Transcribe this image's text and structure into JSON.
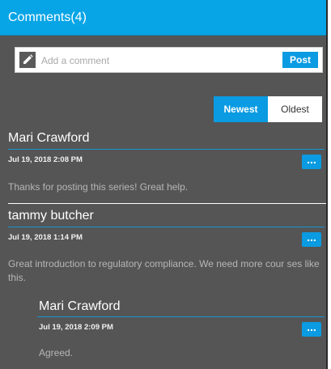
{
  "header": {
    "title": "Comments(4)"
  },
  "compose": {
    "placeholder": "Add a comment",
    "post_label": "Post",
    "icon": "pencil-icon"
  },
  "sort": {
    "options": [
      "Newest",
      "Oldest"
    ],
    "selected": "Newest"
  },
  "comments": [
    {
      "author": "Mari Crawford",
      "date": "Jul 19, 2018 2:08 PM",
      "text": "Thanks for posting this series! Great help.",
      "more_label": "..."
    },
    {
      "author": "tammy butcher",
      "date": "Jul 19, 2018 1:14 PM",
      "text": "Great introduction to regulatory compliance. We need more cour ses like this.",
      "more_label": "...",
      "replies": [
        {
          "author": "Mari Crawford",
          "date": "Jul 19, 2018 2:09 PM",
          "text": "Agreed.",
          "more_label": "..."
        }
      ]
    }
  ],
  "colors": {
    "accent": "#0a9be2",
    "header": "#08a5e6",
    "background": "#555555"
  }
}
